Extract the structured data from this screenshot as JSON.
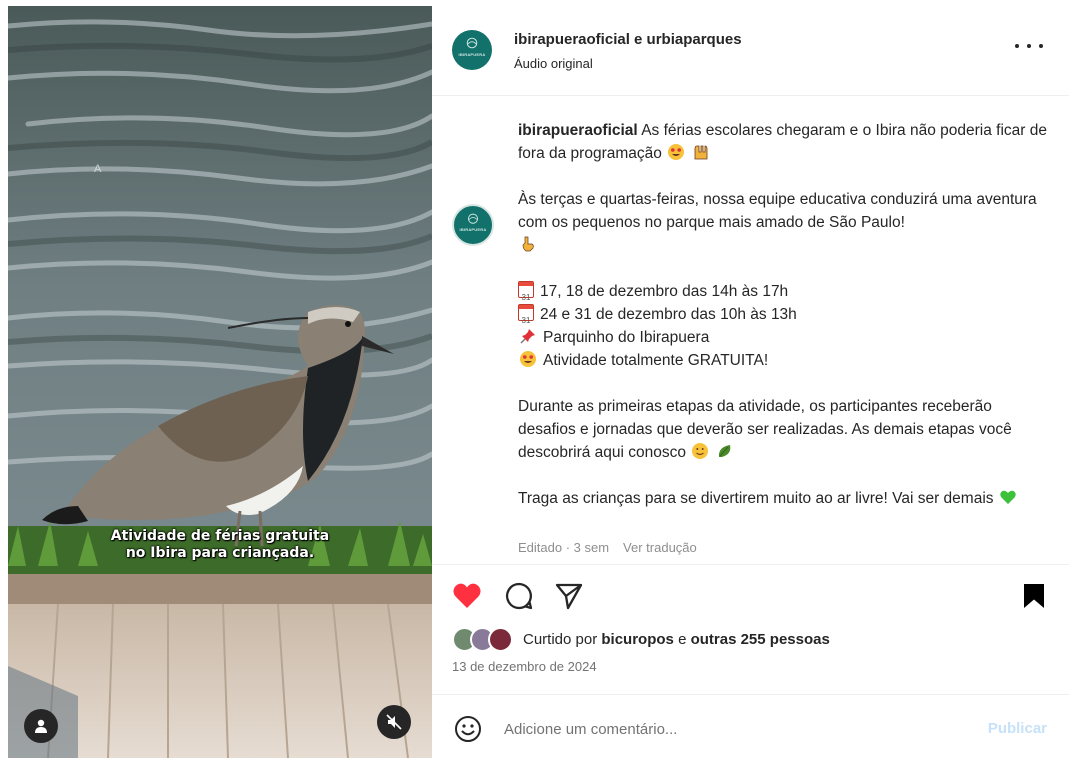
{
  "media": {
    "overlay_mark": "A",
    "caption_line1": "Atividade de férias gratuita",
    "caption_line2": "no Ibira para criançada."
  },
  "header": {
    "title": "ibirapueraoficial e urbiaparques",
    "audio": "Áudio original",
    "avatar_label": "IBIRAPUERA"
  },
  "post": {
    "username": "ibirapueraoficial",
    "line1": "As férias escolares chegaram e o Ibira não poderia ficar de fora da programação",
    "para2": "Às terças e quartas-feiras, nossa equipe educativa conduzirá uma aventura com os pequenos no parque mais amado de São Paulo!",
    "calendar_day": "31",
    "item1": "17, 18 de dezembro das 14h às 17h",
    "item2": "24 e 31 de dezembro das 10h às 13h",
    "item3": "Parquinho do Ibirapuera",
    "item4": "Atividade totalmente GRATUITA!",
    "para4": "Durante as primeiras etapas da atividade, os participantes receberão desafios e jornadas que deverão ser realizadas. As demais etapas você descobrirá aqui conosco",
    "para5": "Traga as crianças para se divertirem muito ao ar livre! Vai ser demais",
    "edited": "Editado · 3 sem",
    "translate": "Ver tradução"
  },
  "likes": {
    "prefix": "Curtido por",
    "user": "bicuropos",
    "connector": "e",
    "others": "outras 255 pessoas"
  },
  "date": "13 de dezembro de 2024",
  "comment": {
    "placeholder": "Adicione um comentário...",
    "publish": "Publicar"
  },
  "colors": {
    "like_red": "#ff3040",
    "brand_teal": "#12716b",
    "publish_disabled": "#c7e1f8",
    "meta_grey": "#8e8e8e"
  },
  "icons": [
    "user-icon",
    "mute-icon",
    "more-icon",
    "heart-icon",
    "comment-icon",
    "share-icon",
    "bookmark-icon",
    "emoji-icon",
    "calendar-icon",
    "pin-icon"
  ]
}
